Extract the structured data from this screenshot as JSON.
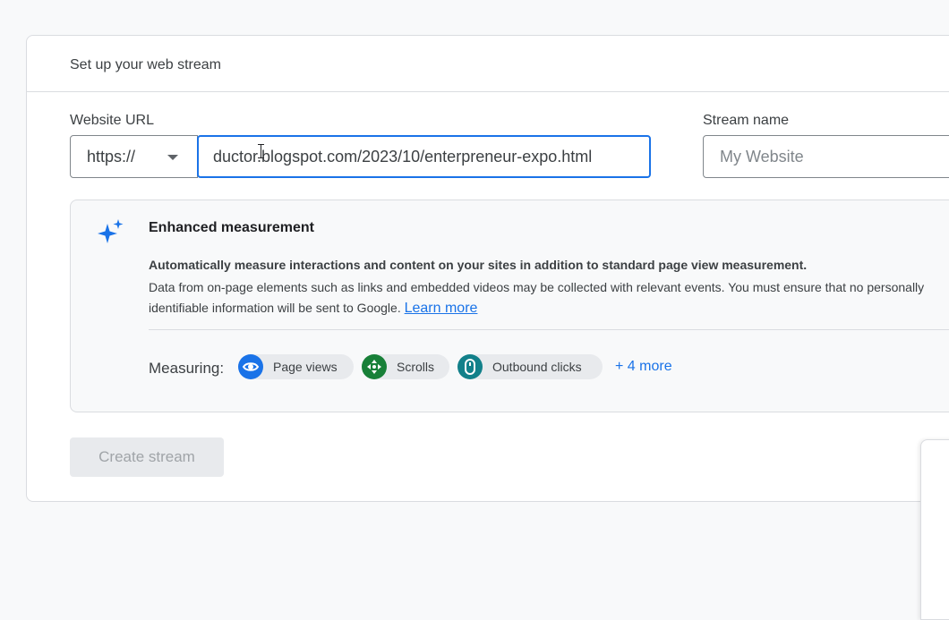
{
  "card": {
    "title": "Set up your web stream"
  },
  "website_url": {
    "label": "Website URL",
    "protocol": "https://",
    "value": "ductor.blogspot.com/2023/10/enterpreneur-expo.html"
  },
  "stream_name": {
    "label": "Stream name",
    "placeholder": "My Website"
  },
  "enhanced_measurement": {
    "title": "Enhanced measurement",
    "bold_text": "Automatically measure interactions and content on your sites in addition to standard page view measurement.",
    "desc_line1": "Data from on-page elements such as links and embedded videos may be collected with relevant events. You must ensure that no personally",
    "desc_line2": "identifiable information will be sent to Google.",
    "learn_more": "Learn more",
    "measuring_label": "Measuring:",
    "chips": [
      {
        "label": "Page views",
        "icon": "eye-icon",
        "color": "#1a73e8"
      },
      {
        "label": "Scrolls",
        "icon": "scroll-arrows-icon",
        "color": "#188038"
      },
      {
        "label": "Outbound clicks",
        "icon": "mouse-icon",
        "color": "#12808a"
      }
    ],
    "more": "+ 4 more"
  },
  "create_button": "Create stream"
}
